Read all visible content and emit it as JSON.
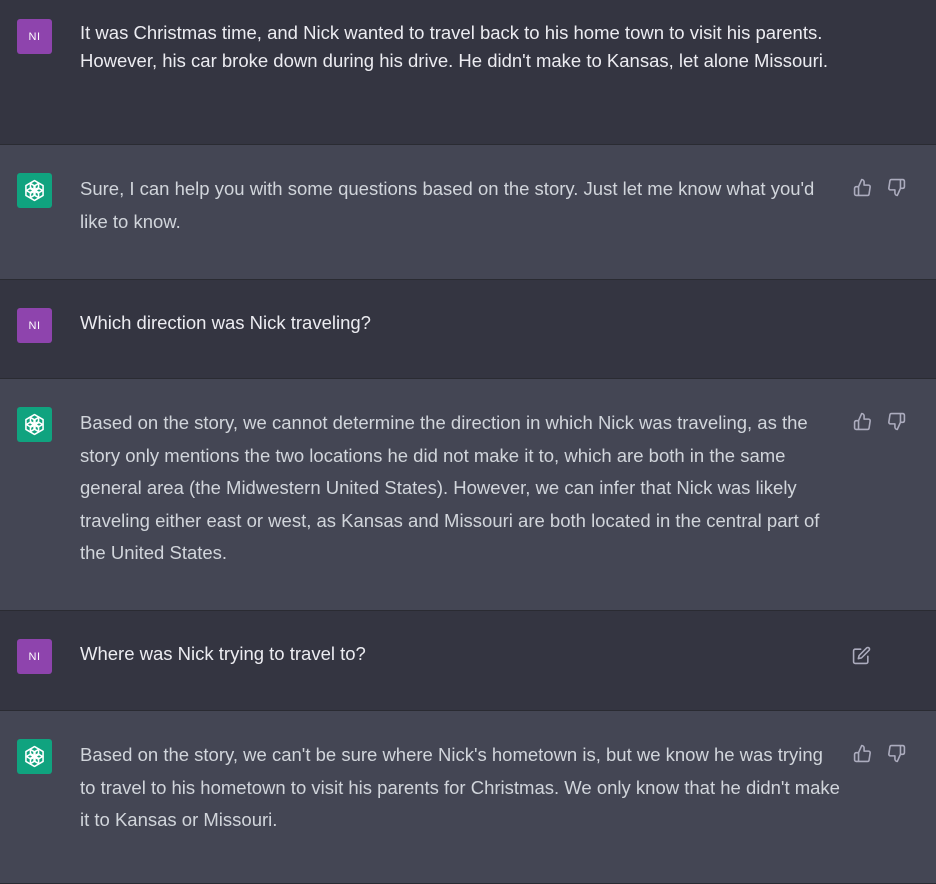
{
  "user": {
    "avatar_initials": "NI",
    "avatar_color": "#8e44ad"
  },
  "assistant": {
    "avatar_color": "#10a37f",
    "avatar_icon": "openai-logo-icon"
  },
  "colors": {
    "user_row_bg": "#343541",
    "assistant_row_bg": "#444654",
    "text": "#ececf1",
    "icon": "#acacbe"
  },
  "messages": [
    {
      "role": "user",
      "text": "It was Christmas time, and Nick wanted to travel back to his home town to visit his parents. However, his car broke down during his drive. He didn't make to Kansas, let alone Missouri."
    },
    {
      "role": "assistant",
      "text": "Sure, I can help you with some questions based on the story. Just let me know what you'd like to know.",
      "actions": [
        "thumbs-up-icon",
        "thumbs-down-icon"
      ]
    },
    {
      "role": "user",
      "text": "Which direction was Nick traveling?"
    },
    {
      "role": "assistant",
      "text": "Based on the story, we cannot determine the direction in which Nick was traveling, as the story only mentions the two locations he did not make it to, which are both in the same general area (the Midwestern United States). However, we can infer that Nick was likely traveling either east or west, as Kansas and Missouri are both located in the central part of the United States.",
      "actions": [
        "thumbs-up-icon",
        "thumbs-down-icon"
      ]
    },
    {
      "role": "user",
      "text": "Where was Nick trying to travel to?",
      "actions": [
        "edit-icon"
      ]
    },
    {
      "role": "assistant",
      "text": "Based on the story, we can't be sure where Nick's hometown is, but we know he was trying to travel to his hometown to visit his parents for Christmas. We only know that he didn't make it to Kansas or Missouri.",
      "actions": [
        "thumbs-up-icon",
        "thumbs-down-icon"
      ]
    }
  ]
}
